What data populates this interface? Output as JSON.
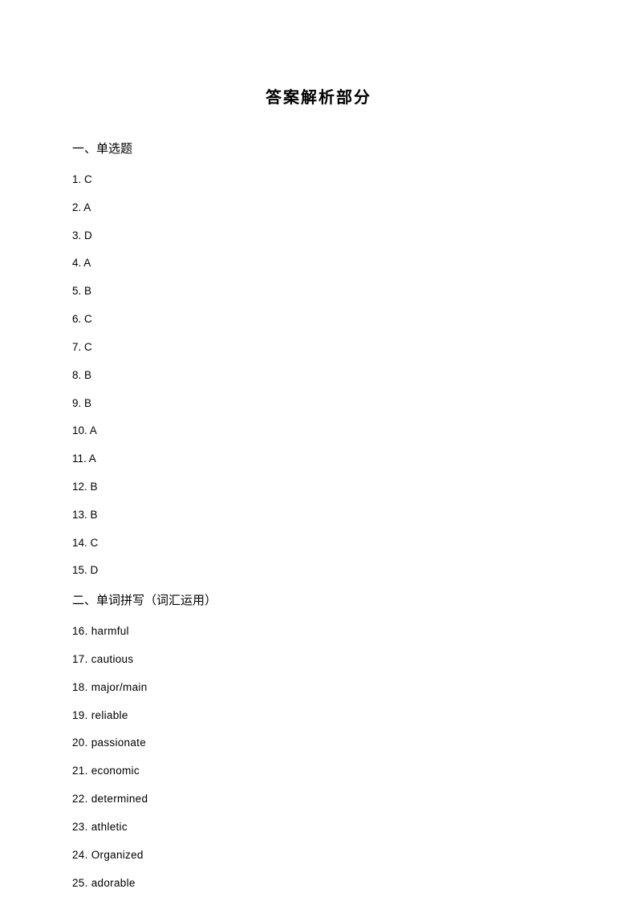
{
  "title": "答案解析部分",
  "sections": [
    {
      "heading": "一、单选题",
      "answers": [
        {
          "num": "1",
          "text": "C"
        },
        {
          "num": "2",
          "text": "A"
        },
        {
          "num": "3",
          "text": "D"
        },
        {
          "num": "4",
          "text": "A"
        },
        {
          "num": "5",
          "text": "B"
        },
        {
          "num": "6",
          "text": "C"
        },
        {
          "num": "7",
          "text": "C"
        },
        {
          "num": "8",
          "text": "B"
        },
        {
          "num": "9",
          "text": "B"
        },
        {
          "num": "10",
          "text": "A"
        },
        {
          "num": "11",
          "text": "A"
        },
        {
          "num": "12",
          "text": "B"
        },
        {
          "num": "13",
          "text": "B"
        },
        {
          "num": "14",
          "text": "C"
        },
        {
          "num": "15",
          "text": "D"
        }
      ]
    },
    {
      "heading": "二、单词拼写（词汇运用）",
      "answers": [
        {
          "num": "16",
          "text": "harmful"
        },
        {
          "num": "17",
          "text": "cautious"
        },
        {
          "num": "18",
          "text": "major/main"
        },
        {
          "num": "19",
          "text": "reliable"
        },
        {
          "num": "20",
          "text": "passionate"
        },
        {
          "num": "21",
          "text": "economic"
        },
        {
          "num": "22",
          "text": "determined"
        },
        {
          "num": "23",
          "text": "athletic"
        },
        {
          "num": "24",
          "text": "Organized"
        },
        {
          "num": "25",
          "text": "adorable"
        }
      ]
    }
  ]
}
